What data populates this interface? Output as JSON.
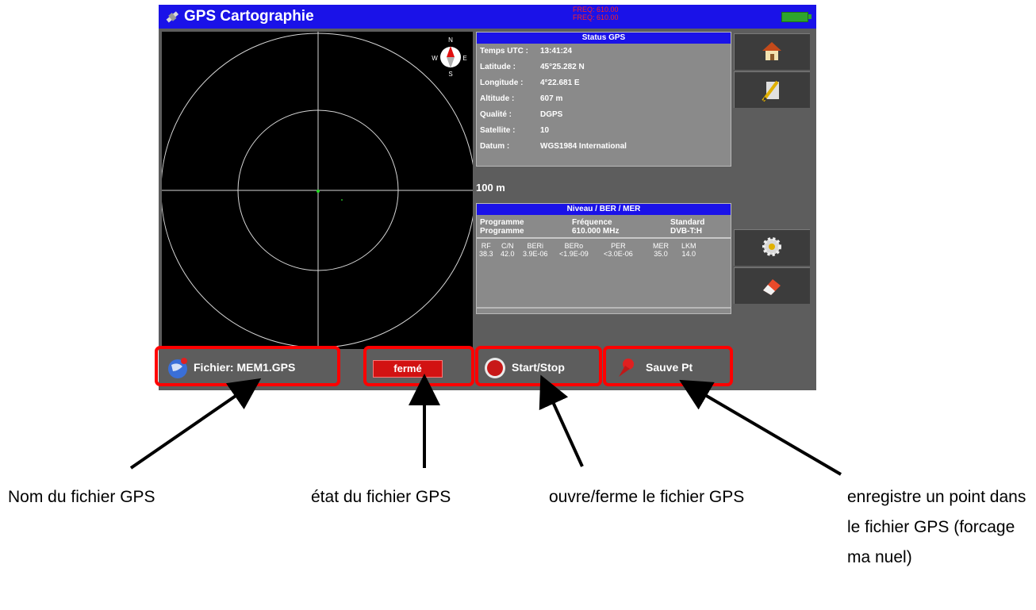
{
  "app": {
    "title": "GPS Cartographie",
    "freq_line1": "FREQ: 610.00",
    "freq_line2": "FREQ: 610.00"
  },
  "map": {
    "scale_label": "100 m",
    "compass": {
      "n": "N",
      "s": "S",
      "e": "E",
      "w": "W"
    }
  },
  "status_gps": {
    "header": "Status GPS",
    "rows": [
      {
        "label": "Temps UTC :",
        "value": "13:41:24"
      },
      {
        "label": "Latitude :",
        "value": "45°25.282 N"
      },
      {
        "label": "Longitude :",
        "value": "4°22.681 E"
      },
      {
        "label": "Altitude :",
        "value": "607 m"
      },
      {
        "label": "Qualité :",
        "value": "DGPS"
      },
      {
        "label": "Satellite :",
        "value": "10"
      },
      {
        "label": "Datum :",
        "value": "WGS1984 International"
      }
    ]
  },
  "niveau": {
    "header": "Niveau / BER / MER",
    "programme_label": "Programme",
    "programme_value": "Programme",
    "frequence_label": "Fréquence",
    "frequence_value": "610.000 MHz",
    "standard_label": "Standard",
    "standard_value": "DVB-T:H",
    "measures": [
      {
        "label": "RF",
        "value": "38.3"
      },
      {
        "label": "C/N",
        "value": "42.0"
      },
      {
        "label": "BERi",
        "value": "3.9E-06"
      },
      {
        "label": "BERo",
        "value": "<1.9E-09"
      },
      {
        "label": "PER",
        "value": "<3.0E-06"
      },
      {
        "label": "MER",
        "value": "35.0"
      },
      {
        "label": "LKM",
        "value": "14.0"
      }
    ]
  },
  "bottom": {
    "fichier": "Fichier: MEM1.GPS",
    "etat": "fermé",
    "start_stop": "Start/Stop",
    "sauve": "Sauve Pt"
  },
  "captions": {
    "c1": "Nom du fichier GPS",
    "c2": "état du fichier GPS",
    "c3": "ouvre/ferme le fichier GPS",
    "c4": "enregistre un point dans le fichier GPS (forcage ma nuel)"
  },
  "colors": {
    "title_bar": "#1a12e8",
    "highlight": "#ff0000",
    "etat_bg": "#d21212"
  },
  "icons": [
    "gps-satellite-icon",
    "home-icon",
    "edit-icon",
    "settings-icon",
    "eraser-icon",
    "globe-icon",
    "record-icon",
    "pin-icon",
    "compass-icon"
  ]
}
